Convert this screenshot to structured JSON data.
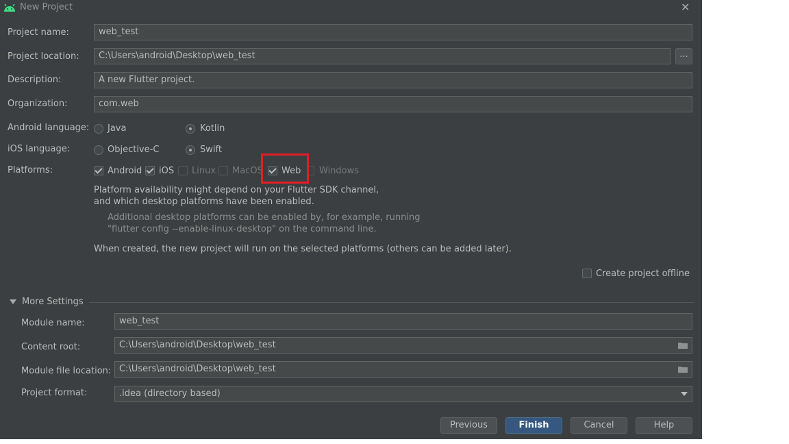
{
  "window": {
    "title": "New Project",
    "close_glyph": "✕",
    "app_icon": "android-icon"
  },
  "fields": {
    "project_name": {
      "label": "Project name:",
      "value": "web_test"
    },
    "project_location": {
      "label": "Project location:",
      "value": "C:\\Users\\android\\Desktop\\web_test",
      "browse": "..."
    },
    "description": {
      "label": "Description:",
      "value": "A new Flutter project."
    },
    "organization": {
      "label": "Organization:",
      "value": "com.web"
    }
  },
  "android_language": {
    "label": "Android language:",
    "options": [
      "Java",
      "Kotlin"
    ],
    "selected": "Kotlin"
  },
  "ios_language": {
    "label": "iOS language:",
    "options": [
      "Objective-C",
      "Swift"
    ],
    "selected": "Swift"
  },
  "platforms": {
    "label": "Platforms:",
    "items": [
      {
        "name": "Android",
        "checked": true,
        "enabled": true
      },
      {
        "name": "iOS",
        "checked": true,
        "enabled": true
      },
      {
        "name": "Linux",
        "checked": false,
        "enabled": false
      },
      {
        "name": "MacOS",
        "checked": false,
        "enabled": false
      },
      {
        "name": "Web",
        "checked": true,
        "enabled": true
      },
      {
        "name": "Windows",
        "checked": false,
        "enabled": false
      }
    ],
    "highlight_color": "#e01f25"
  },
  "notes": {
    "availability_line1": "Platform availability might depend on your Flutter SDK channel,",
    "availability_line2": "and which desktop platforms have been enabled.",
    "additional_line1": "Additional desktop platforms can be enabled by, for example, running",
    "additional_line2": "\"flutter config --enable-linux-desktop\" on the command line.",
    "when_created": "When created, the new project will run on the selected platforms (others can be added later)."
  },
  "offline": {
    "label": "Create project offline",
    "checked": false
  },
  "more_settings": {
    "title": "More Settings",
    "module_name": {
      "label": "Module name:",
      "value": "web_test"
    },
    "content_root": {
      "label": "Content root:",
      "value": "C:\\Users\\android\\Desktop\\web_test"
    },
    "module_file_location": {
      "label": "Module file location:",
      "value": "C:\\Users\\android\\Desktop\\web_test"
    },
    "project_format": {
      "label": "Project format:",
      "value": ".idea (directory based)"
    }
  },
  "buttons": {
    "previous": "Previous",
    "finish": "Finish",
    "cancel": "Cancel",
    "help": "Help"
  },
  "colors": {
    "background": "#3c3f41",
    "field": "#45494a",
    "primary_button": "#365880"
  }
}
